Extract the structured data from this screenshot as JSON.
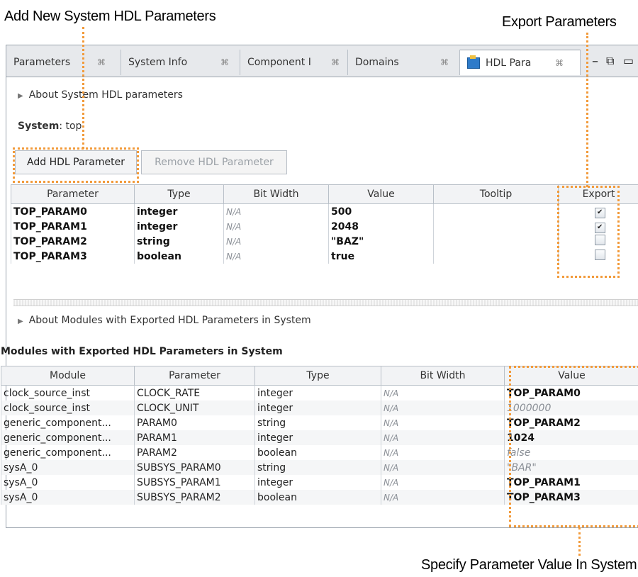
{
  "callouts": {
    "add_new": "Add New System HDL Parameters",
    "export": "Export Parameters",
    "specify": "Specify Parameter Value In System"
  },
  "tabs": [
    {
      "label": "Parameters"
    },
    {
      "label": "System Info"
    },
    {
      "label": "Component I"
    },
    {
      "label": "Domains"
    },
    {
      "label": "HDL Para"
    }
  ],
  "top": {
    "about": "About System HDL parameters",
    "system_label": "System",
    "system_value": ": top",
    "add_button": "Add HDL Parameter",
    "remove_button": "Remove HDL Parameter",
    "headers": [
      "Parameter",
      "Type",
      "Bit Width",
      "Value",
      "Tooltip",
      "Export"
    ],
    "rows": [
      {
        "parameter": "TOP_PARAM0",
        "type": "integer",
        "bit_width": "N/A",
        "value": "500",
        "tooltip": "",
        "export": true
      },
      {
        "parameter": "TOP_PARAM1",
        "type": "integer",
        "bit_width": "N/A",
        "value": "2048",
        "tooltip": "",
        "export": true
      },
      {
        "parameter": "TOP_PARAM2",
        "type": "string",
        "bit_width": "N/A",
        "value": "\"BAZ\"",
        "tooltip": "",
        "export": false
      },
      {
        "parameter": "TOP_PARAM3",
        "type": "boolean",
        "bit_width": "N/A",
        "value": "true",
        "tooltip": "",
        "export": false
      }
    ]
  },
  "bottom": {
    "about": "About Modules with Exported HDL Parameters in System",
    "title": "Modules with Exported HDL Parameters in System",
    "headers": [
      "Module",
      "Parameter",
      "Type",
      "Bit Width",
      "Value"
    ],
    "rows": [
      {
        "module": "clock_source_inst",
        "parameter": "CLOCK_RATE",
        "type": "integer",
        "bit_width": "N/A",
        "value": "TOP_PARAM0"
      },
      {
        "module": "clock_source_inst",
        "parameter": "CLOCK_UNIT",
        "type": "integer",
        "bit_width": "N/A",
        "value": "1000000"
      },
      {
        "module": "generic_component...",
        "parameter": "PARAM0",
        "type": "string",
        "bit_width": "N/A",
        "value": "TOP_PARAM2"
      },
      {
        "module": "generic_component...",
        "parameter": "PARAM1",
        "type": "integer",
        "bit_width": "N/A",
        "value": "1024"
      },
      {
        "module": "generic_component...",
        "parameter": "PARAM2",
        "type": "boolean",
        "bit_width": "N/A",
        "value": "false"
      },
      {
        "module": "sysA_0",
        "parameter": "SUBSYS_PARAM0",
        "type": "string",
        "bit_width": "N/A",
        "value": "\"BAR\""
      },
      {
        "module": "sysA_0",
        "parameter": "SUBSYS_PARAM1",
        "type": "integer",
        "bit_width": "N/A",
        "value": "TOP_PARAM1"
      },
      {
        "module": "sysA_0",
        "parameter": "SUBSYS_PARAM2",
        "type": "boolean",
        "bit_width": "N/A",
        "value": "TOP_PARAM3"
      }
    ]
  },
  "colors": {
    "callout_accent": "#f29a3a"
  }
}
